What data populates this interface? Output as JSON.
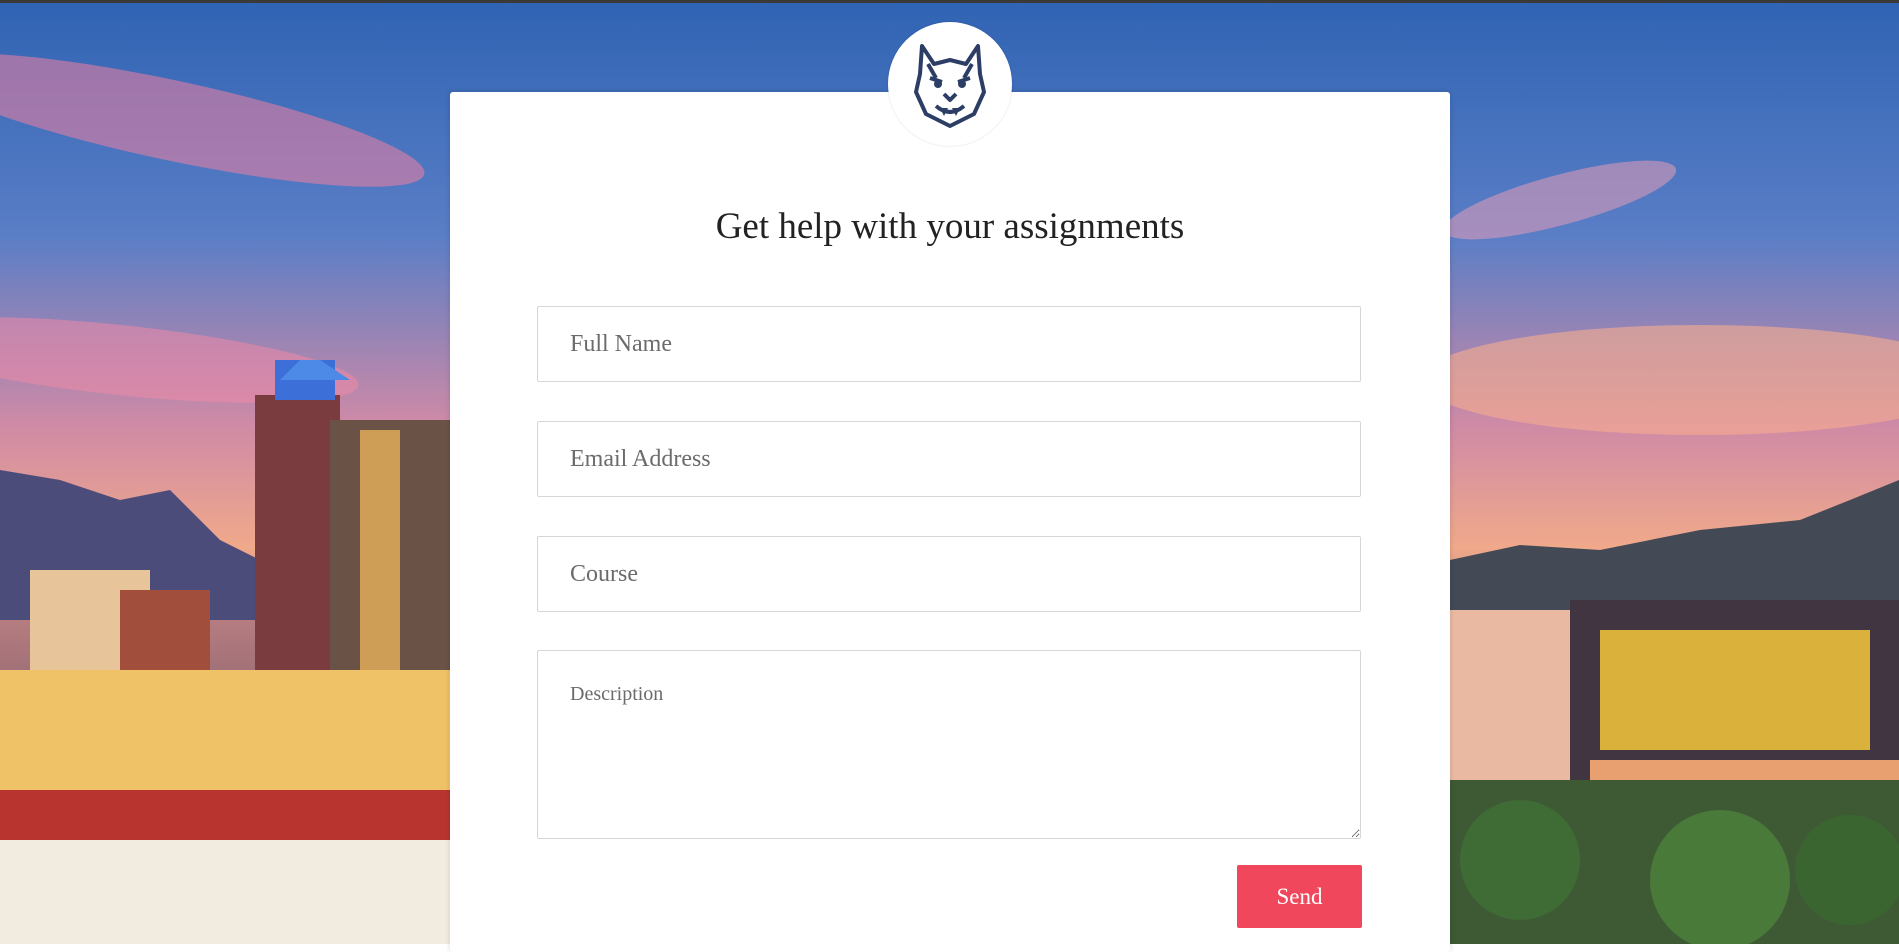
{
  "header": {
    "logo_icon": "wildcat-mascot-icon",
    "title": "Get help with your assignments"
  },
  "form": {
    "full_name": {
      "placeholder": "Full Name",
      "value": ""
    },
    "email": {
      "placeholder": "Email Address",
      "value": ""
    },
    "course": {
      "placeholder": "Course",
      "value": ""
    },
    "description": {
      "placeholder": "Description",
      "value": ""
    },
    "send_label": "Send"
  },
  "colors": {
    "accent": "#f0475c",
    "card": "#ffffff",
    "logo": "#2d3e66"
  },
  "background": {
    "scene": "city-skyline-at-sunset"
  }
}
